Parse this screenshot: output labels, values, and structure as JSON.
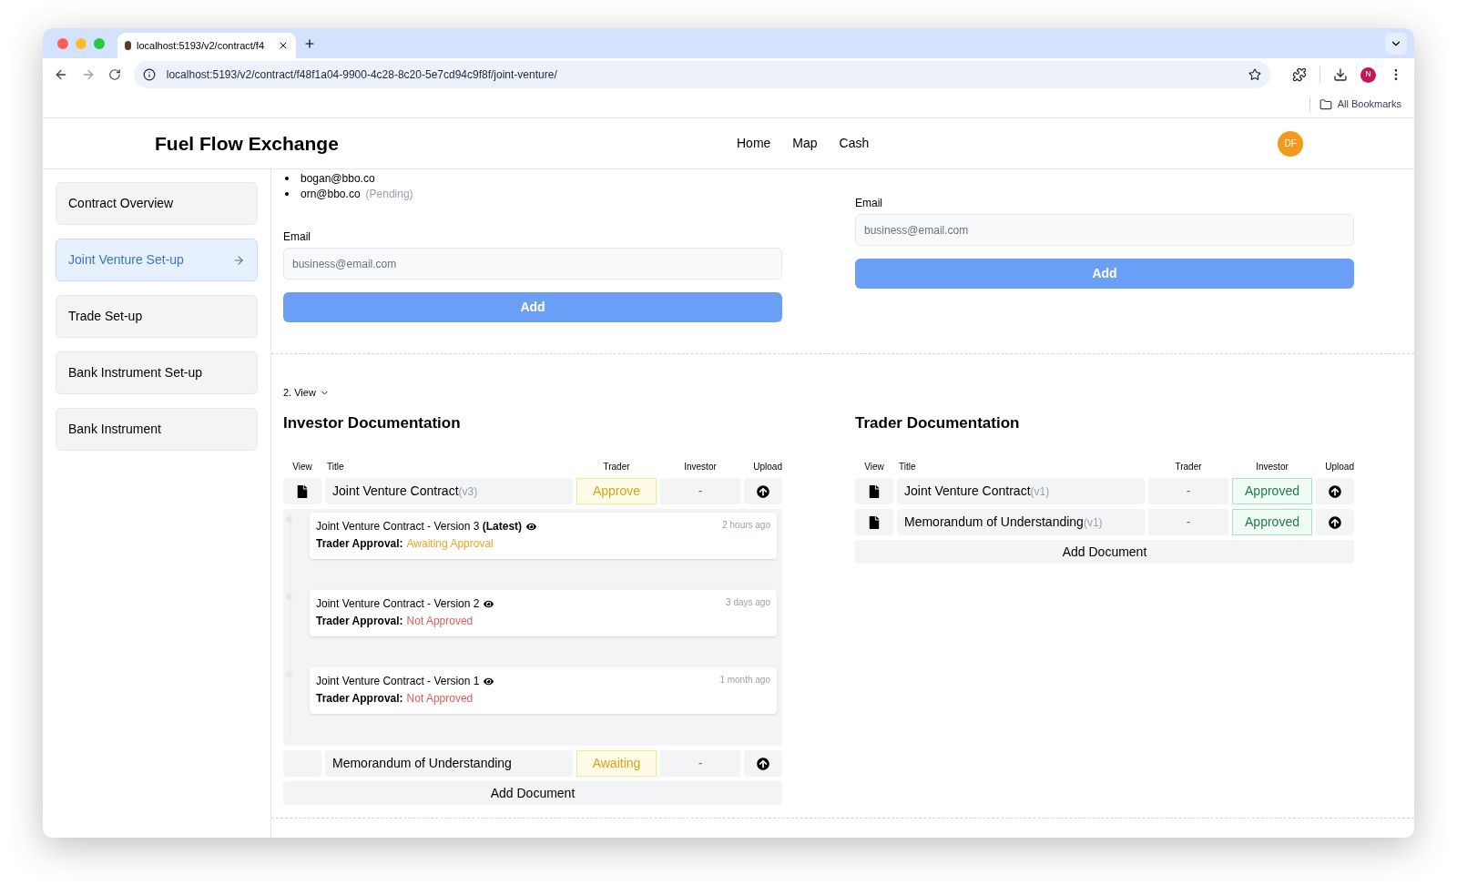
{
  "browser": {
    "tab": {
      "title": "localhost:5193/v2/contract/f4"
    },
    "url": "localhost:5193/v2/contract/f48f1a04-9900-4c28-8c20-5e7cd94c9f8f/joint-venture/",
    "profile": "N",
    "bookmarks": "All Bookmarks"
  },
  "header": {
    "brand": "Fuel Flow Exchange",
    "nav": [
      "Home",
      "Map",
      "Cash"
    ],
    "avatar": "DF"
  },
  "sidebar": {
    "items": [
      {
        "label": "Contract Overview",
        "selected": false
      },
      {
        "label": "Joint Venture Set-up",
        "selected": true
      },
      {
        "label": "Trade Set-up",
        "selected": false
      },
      {
        "label": "Bank Instrument Set-up",
        "selected": false
      },
      {
        "label": "Bank Instrument",
        "selected": false
      }
    ]
  },
  "left_panel": {
    "members": [
      {
        "email": "bogan@bbo.co"
      },
      {
        "email": "orn@bbo.co",
        "status": "(Pending)"
      }
    ],
    "email_label": "Email",
    "placeholder": "business@email.com",
    "button": "Add"
  },
  "right_panel": {
    "email_label": "Email",
    "placeholder": "business@email.com",
    "button": "Add"
  },
  "section_toggle": "2. View",
  "documents": [
    {
      "title": "Investor Documentation",
      "columns": [
        "View",
        "Title",
        "Trader",
        "Investor",
        "Upload"
      ],
      "rows": [
        {
          "has_file": true,
          "title": "Joint Venture Contract",
          "version": "(v3)",
          "trader": {
            "kind": "pending",
            "text": "Approve"
          },
          "investor": {
            "kind": "none",
            "text": "-"
          },
          "history": [
            {
              "title": "Joint Venture Contract - Version 3 **(Latest)**",
              "approval_label": "Trader Approval:",
              "approval": "Awaiting Approval",
              "color": "#e3a92b",
              "time": "2 hours ago"
            },
            {
              "title": "Joint Venture Contract - Version 2",
              "approval_label": "Trader Approval:",
              "approval": "Not Approved",
              "color": "#e05a5a",
              "time": "3 days ago"
            },
            {
              "title": "Joint Venture Contract - Version 1",
              "approval_label": "Trader Approval:",
              "approval": "Not Approved",
              "color": "#e05a5a",
              "time": "1 month ago"
            }
          ]
        },
        {
          "has_file": false,
          "title": "Memorandum of Understanding",
          "trader": {
            "kind": "pending",
            "text": "Awaiting"
          },
          "investor": {
            "kind": "none",
            "text": "-"
          }
        }
      ],
      "add_button": "Add Document"
    },
    {
      "title": "Trader Documentation",
      "columns": [
        "View",
        "Title",
        "Trader",
        "Investor",
        "Upload"
      ],
      "rows": [
        {
          "has_file": true,
          "title": "Joint Venture Contract",
          "version": "(v1)",
          "trader": {
            "kind": "none",
            "text": "-"
          },
          "investor": {
            "kind": "approved",
            "text": "Approved"
          }
        },
        {
          "has_file": true,
          "title": "Memorandum of Understanding",
          "version": "(v1)",
          "trader": {
            "kind": "none",
            "text": "-"
          },
          "investor": {
            "kind": "approved",
            "text": "Approved"
          }
        }
      ],
      "add_button": "Add Document"
    }
  ]
}
